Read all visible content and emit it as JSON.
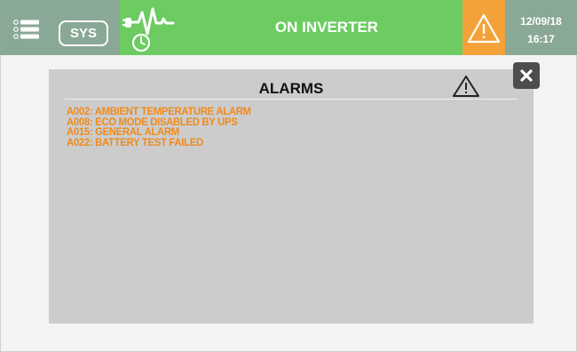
{
  "header": {
    "sys_label": "SYS",
    "status": "ON INVERTER",
    "date": "12/09/18",
    "time": "16:17",
    "icons": [
      "menu-icon",
      "power-timer-icon",
      "warning-icon"
    ]
  },
  "alarms_dialog": {
    "title": "ALARMS",
    "alarms": [
      "A002: AMBIENT TEMPERATURE ALARM",
      "A008: ECO MODE DISABLED BY UPS",
      "A015: GENERAL ALARM",
      "A022: BATTERY TEST FAILED"
    ],
    "icons": [
      "warning-icon",
      "close-icon"
    ]
  },
  "colors": {
    "header_gray": "#8aa896",
    "status_green": "#6ccb61",
    "warning_orange": "#f3a23a",
    "alarm_text": "#f08a1a",
    "dialog_bg": "#cccccc"
  }
}
